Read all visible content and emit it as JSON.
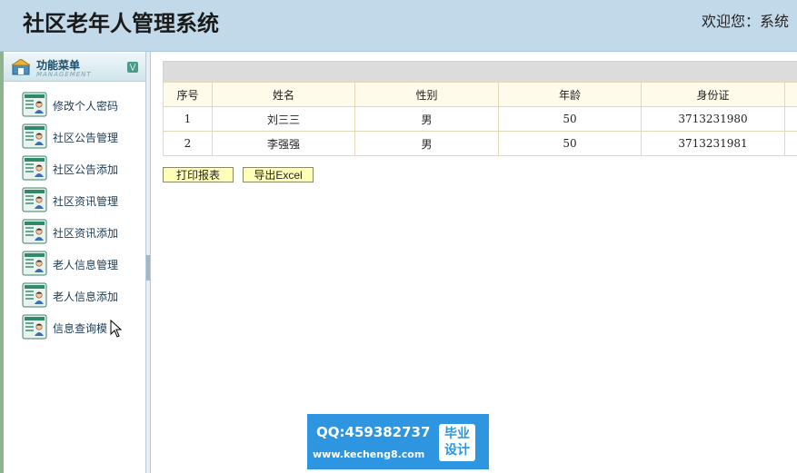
{
  "header": {
    "title": "社区老年人管理系统",
    "welcome": "欢迎您：系统"
  },
  "sidebar": {
    "menu_title": "功能菜单",
    "menu_subtitle": "MANAGEMENT",
    "items": [
      {
        "label": "修改个人密码"
      },
      {
        "label": "社区公告管理"
      },
      {
        "label": "社区公告添加"
      },
      {
        "label": "社区资讯管理"
      },
      {
        "label": "社区资讯添加"
      },
      {
        "label": "老人信息管理"
      },
      {
        "label": "老人信息添加"
      },
      {
        "label": "信息查询模"
      }
    ]
  },
  "table": {
    "columns": [
      "序号",
      "姓名",
      "性别",
      "年龄",
      "身份证"
    ],
    "rows": [
      {
        "index": "1",
        "name": "刘三三",
        "gender": "男",
        "age": "50",
        "id_card": "3713231980"
      },
      {
        "index": "2",
        "name": "李强强",
        "gender": "男",
        "age": "50",
        "id_card": "3713231981"
      }
    ]
  },
  "actions": {
    "print_label": "打印报表",
    "excel_label": "导出Excel"
  },
  "watermark": {
    "qq": "QQ:459382737",
    "url": "www.kecheng8.com",
    "badge_line1": "毕业",
    "badge_line2": "设计"
  },
  "colors": {
    "header_bg": "#c2d9ea",
    "button_bg": "#ffffb8",
    "table_header_bg": "#fffbea",
    "watermark_bg": "#2e95e0"
  }
}
